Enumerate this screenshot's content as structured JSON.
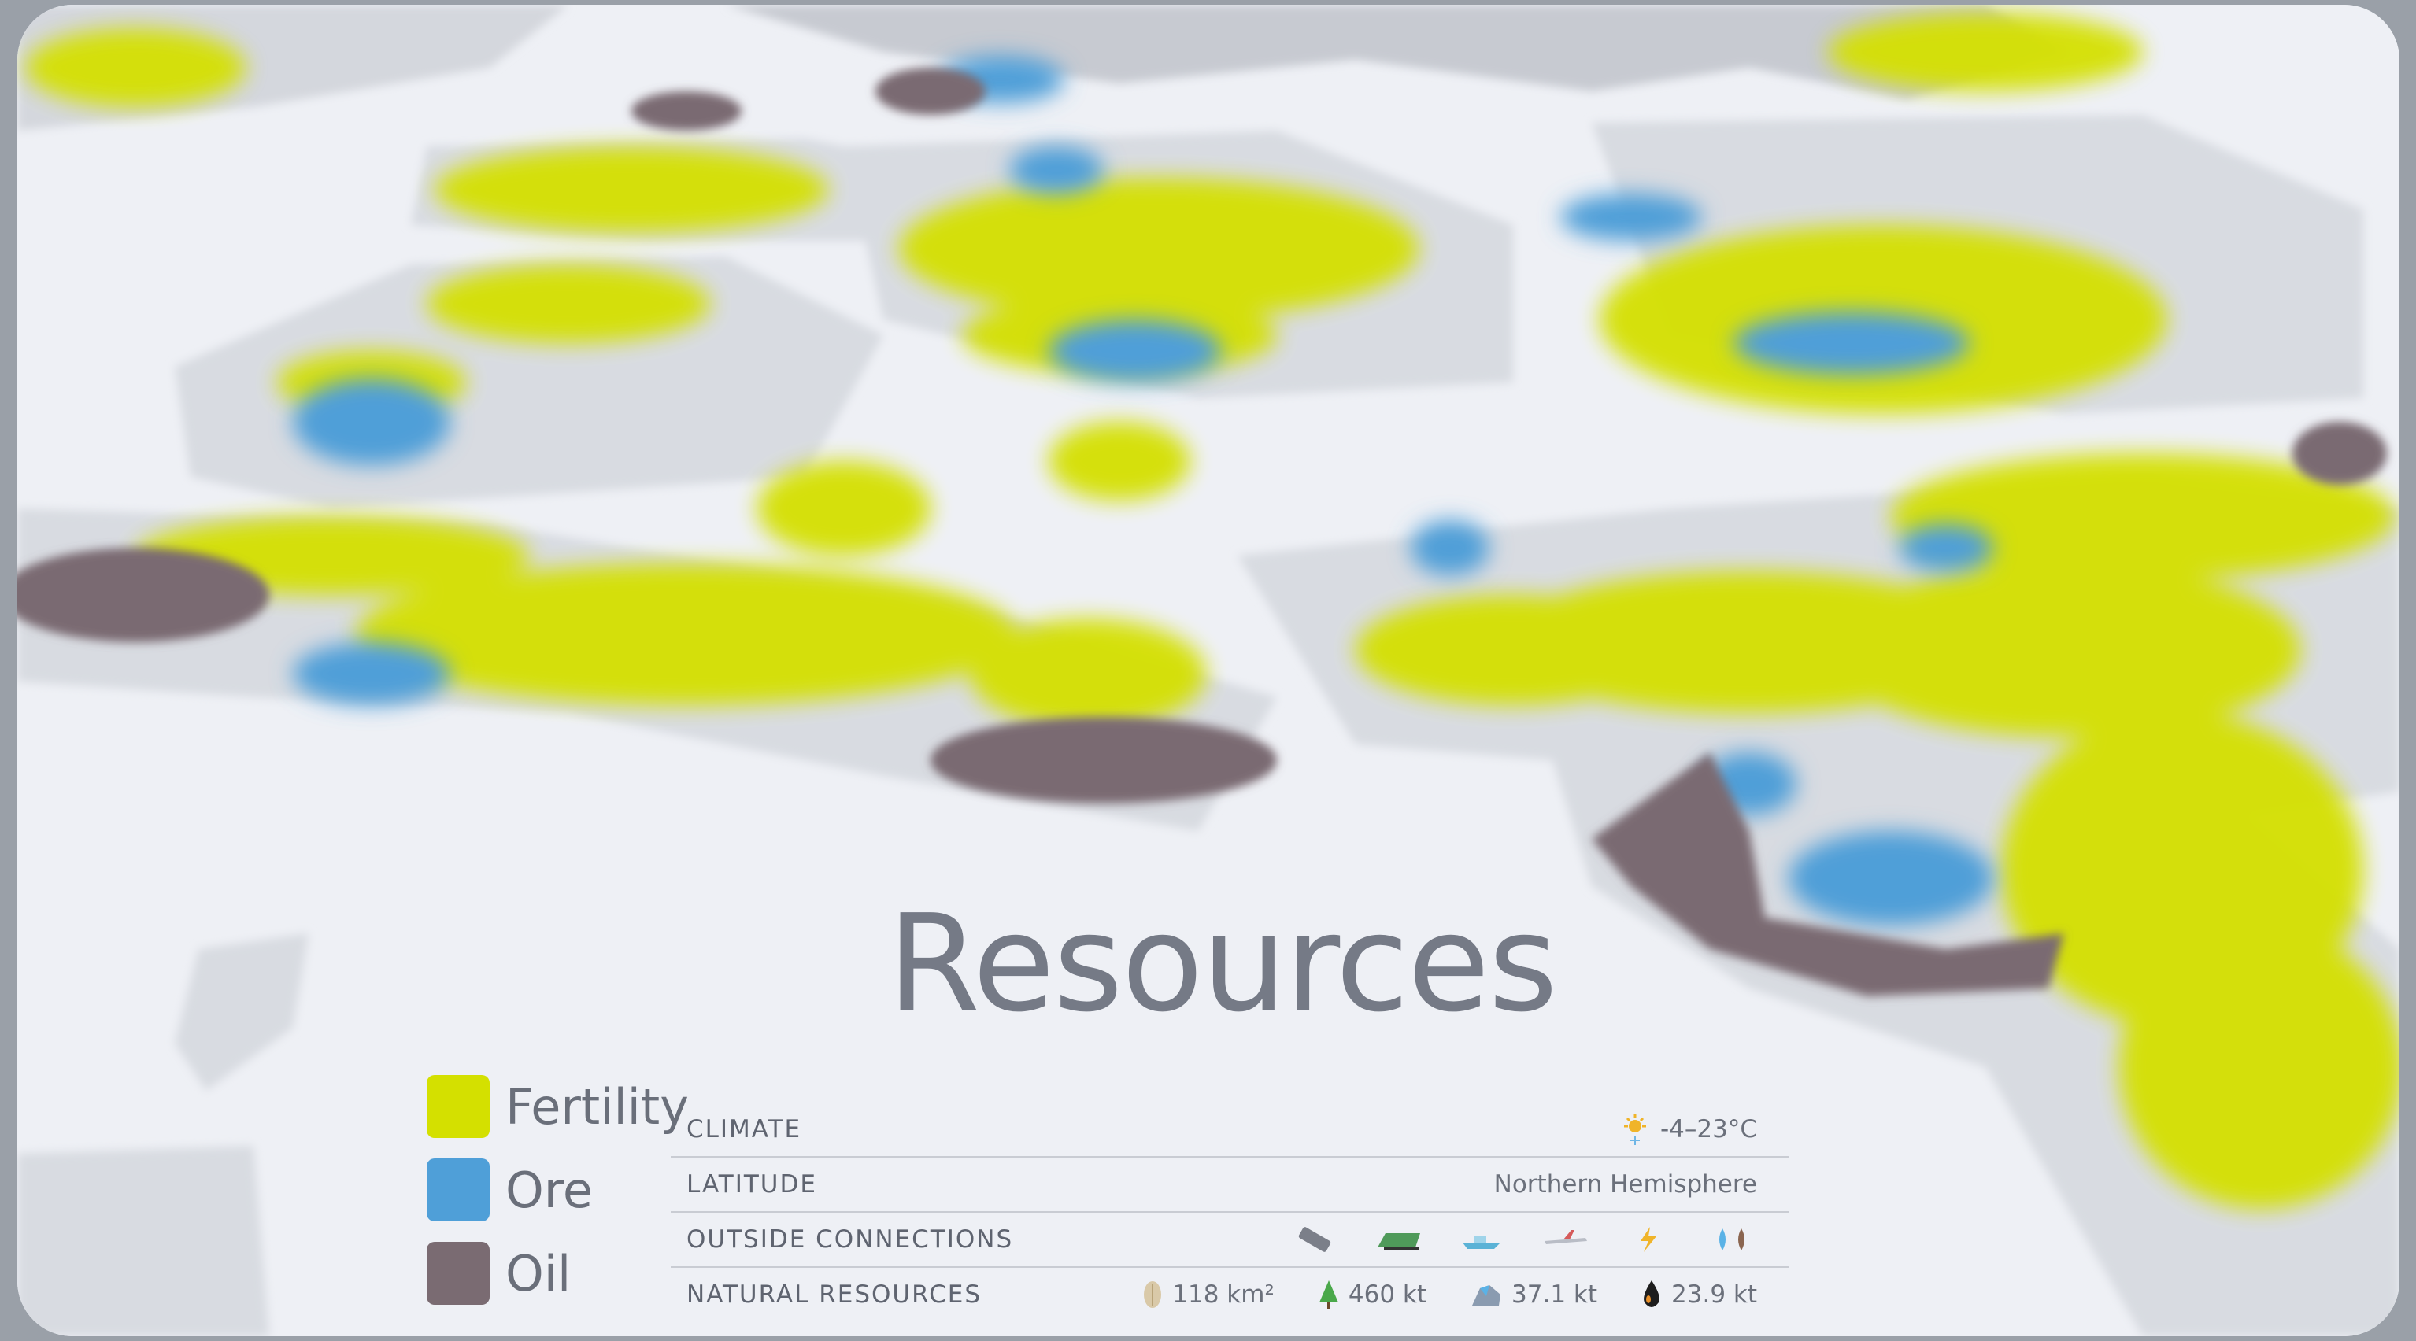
{
  "title": "Resources",
  "legend": [
    {
      "label": "Fertility",
      "color": "#d4e000"
    },
    {
      "label": "Ore",
      "color": "#4f9fd8"
    },
    {
      "label": "Oil",
      "color": "#7a6b72"
    }
  ],
  "info": {
    "climate": {
      "label": "CLIMATE",
      "value": "-4–23°C",
      "icon": "sun-snowflake-icon"
    },
    "latitude": {
      "label": "LATITUDE",
      "value": "Northern Hemisphere"
    },
    "outside_connections": {
      "label": "OUTSIDE CONNECTIONS",
      "icons": [
        "road-icon",
        "train-icon",
        "ship-icon",
        "airplane-icon",
        "electricity-icon",
        "water-sewage-icon"
      ]
    },
    "natural_resources": {
      "label": "NATURAL RESOURCES",
      "items": [
        {
          "icon": "fertile-land-icon",
          "value": "118 km²"
        },
        {
          "icon": "forest-icon",
          "value": "460 kt"
        },
        {
          "icon": "ore-icon",
          "value": "37.1 kt"
        },
        {
          "icon": "oil-drop-icon",
          "value": "23.9 kt"
        }
      ]
    }
  },
  "colors": {
    "fertility": "#d4e000",
    "ore": "#4f9fd8",
    "oil": "#7a6b72",
    "land": "#dfe2e8",
    "water": "#f0f2f6"
  }
}
